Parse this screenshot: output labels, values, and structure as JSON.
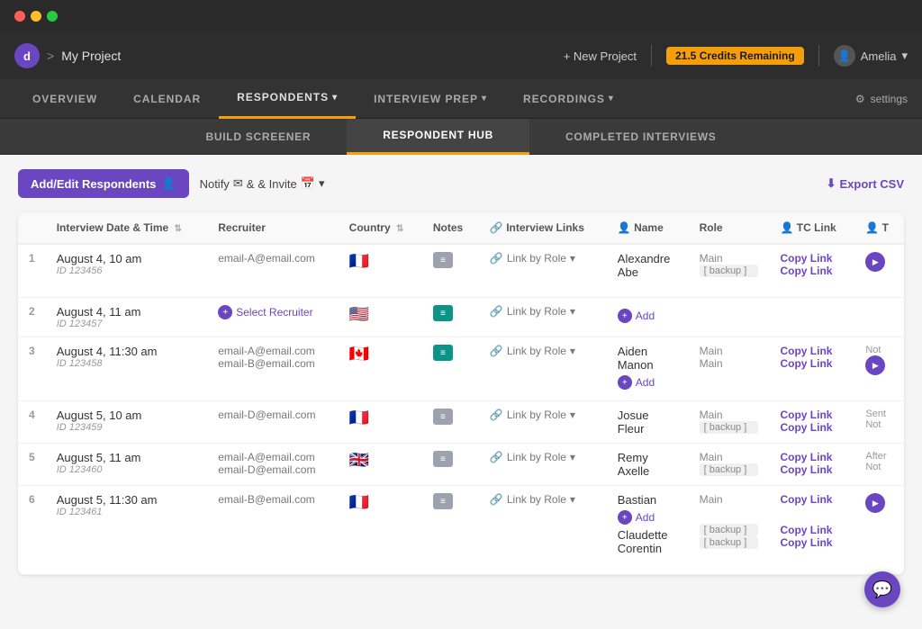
{
  "titleBar": {
    "appLogo": "d",
    "separator": ">",
    "projectName": "My Project"
  },
  "topNav": {
    "newProject": "+ New Project",
    "credits": "21.5 Credits Remaining",
    "userName": "Amelia"
  },
  "mainTabs": [
    {
      "id": "overview",
      "label": "OVERVIEW",
      "active": false
    },
    {
      "id": "calendar",
      "label": "CALENDAR",
      "active": false
    },
    {
      "id": "respondents",
      "label": "RESPONDENTS",
      "active": true,
      "hasArrow": true
    },
    {
      "id": "interview-prep",
      "label": "INTERVIEW PREP",
      "active": false,
      "hasArrow": true
    },
    {
      "id": "recordings",
      "label": "RECORDINGS",
      "active": false,
      "hasArrow": true
    }
  ],
  "settingsLabel": "settings",
  "subTabs": [
    {
      "id": "build-screener",
      "label": "BUILD SCREENER",
      "active": false
    },
    {
      "id": "respondent-hub",
      "label": "RESPONDENT HUB",
      "active": true
    },
    {
      "id": "completed-interviews",
      "label": "COMPLETED INTERVIEWS",
      "active": false
    }
  ],
  "toolbar": {
    "addRespondents": "Add/Edit Respondents",
    "notify": "Notify",
    "invite": "& Invite",
    "exportCsv": "Export CSV"
  },
  "tableHeaders": {
    "num": "#",
    "interviewDateTime": "Interview Date & Time",
    "recruiter": "Recruiter",
    "country": "Country",
    "notes": "Notes",
    "interviewLinks": "Interview Links",
    "name": "Name",
    "role": "Role",
    "tcLink": "TC Link",
    "t": "T"
  },
  "rows": [
    {
      "num": "1",
      "date": "August 4, 10 am",
      "id": "ID 123456",
      "recruiter": "email-A@email.com",
      "flag": "🇫🇷",
      "notesTeal": false,
      "linkLabel": "Link by Role",
      "persons": [
        {
          "name": "Alexandre",
          "role": "Main",
          "copyLink": "Copy Link",
          "playBtn": true,
          "status": ""
        },
        {
          "name": "Abe",
          "role": "[ backup ]",
          "copyLink": "Copy Link",
          "playBtn": false,
          "status": ""
        }
      ]
    },
    {
      "num": "2",
      "date": "August 4, 11 am",
      "id": "ID 123457",
      "recruiter": "SELECT_RECRUITER",
      "flag": "🇺🇸",
      "notesTeal": true,
      "linkLabel": "Link by Role",
      "persons": [
        {
          "name": "+ Add",
          "role": "",
          "copyLink": "",
          "playBtn": false,
          "status": "",
          "isAdd": true
        }
      ]
    },
    {
      "num": "3",
      "date": "August 4, 11:30 am",
      "id": "ID 123458",
      "recruiter2": "email-B@email.com",
      "recruiter": "email-A@email.com",
      "flag": "🇨🇦",
      "notesTeal": true,
      "linkLabel": "Link by Role",
      "persons": [
        {
          "name": "Aiden",
          "role": "Main",
          "copyLink": "Copy Link",
          "playBtn": false,
          "status": "Not"
        },
        {
          "name": "Manon",
          "role": "Main",
          "copyLink": "Copy Link",
          "playBtn": true,
          "status": ""
        },
        {
          "name": "+ Add",
          "role": "",
          "copyLink": "",
          "playBtn": false,
          "status": "",
          "isAdd": true
        }
      ]
    },
    {
      "num": "4",
      "date": "August 5, 10 am",
      "id": "ID 123459",
      "recruiter": "email-D@email.com",
      "flag": "🇫🇷",
      "notesTeal": false,
      "linkLabel": "Link by Role",
      "persons": [
        {
          "name": "Josue",
          "role": "Main",
          "copyLink": "Copy Link",
          "playBtn": false,
          "status": "Sent"
        },
        {
          "name": "Fleur",
          "role": "[ backup ]",
          "copyLink": "Copy Link",
          "playBtn": false,
          "status": "Not"
        }
      ]
    },
    {
      "num": "5",
      "date": "August 5, 11 am",
      "id": "ID 123460",
      "recruiter": "email-A@email.com",
      "recruiter2": "email-D@email.com",
      "flag": "🇬🇧",
      "notesTeal": false,
      "linkLabel": "Link by Role",
      "persons": [
        {
          "name": "Remy",
          "role": "Main",
          "copyLink": "Copy Link",
          "playBtn": false,
          "status": "After"
        },
        {
          "name": "Axelle",
          "role": "[ backup ]",
          "copyLink": "Copy Link",
          "playBtn": false,
          "status": "Not"
        }
      ]
    },
    {
      "num": "6",
      "date": "August 5, 11:30 am",
      "id": "ID 123461",
      "recruiter": "email-B@email.com",
      "flag": "🇫🇷",
      "notesTeal": false,
      "linkLabel": "Link by Role",
      "persons": [
        {
          "name": "Bastian",
          "role": "Main",
          "copyLink": "Copy Link",
          "playBtn": true,
          "status": ""
        },
        {
          "name": "+ Add",
          "role": "",
          "copyLink": "",
          "playBtn": false,
          "status": "",
          "isAdd": true
        },
        {
          "name": "Claudette",
          "role": "[ backup ]",
          "copyLink": "Copy Link",
          "playBtn": false,
          "status": ""
        },
        {
          "name": "Corentin",
          "role": "[ backup ]",
          "copyLink": "Copy Link",
          "playBtn": false,
          "status": ""
        }
      ]
    }
  ]
}
